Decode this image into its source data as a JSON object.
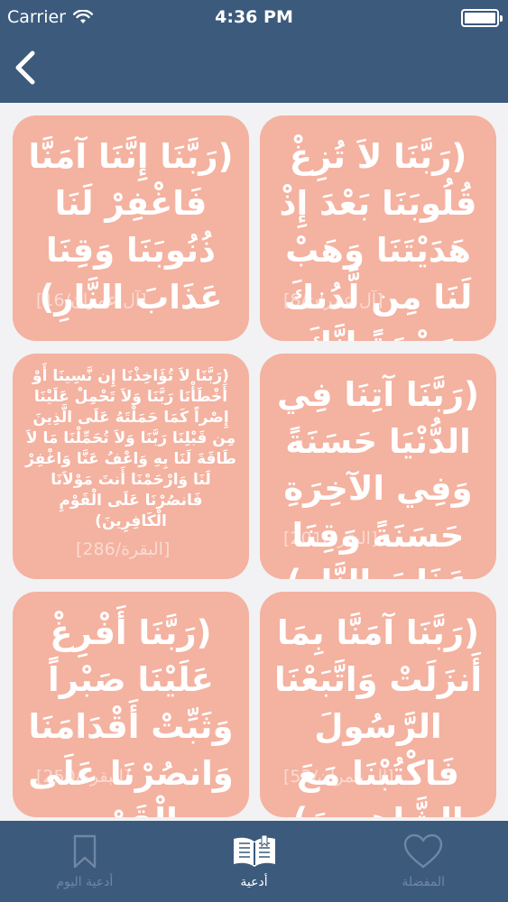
{
  "status": {
    "carrier": "Carrier",
    "time": "4:36 PM"
  },
  "cards": [
    {
      "text": "(رَبَّنَا لاَ تُزِغْ قُلُوبَنَا بَعْدَ إِذْ هَدَيْتَنَا وَهَبْ لَنَا مِن لَّدُنكَ رَحْمَةً إِنَّكَ أَنتَ الْوَهَّابُ)",
      "ref": "[آل عمران/8]"
    },
    {
      "text": "(رَبَّنَا إِنَّنَا آمَنَّا فَاغْفِرْ لَنَا ذُنُوبَنَا وَقِنَا عَذَابَ النَّارِ)",
      "ref": "[آل عمران/16]"
    },
    {
      "text": "(رَبَّنَا آتِنَا فِي الدُّنْيَا حَسَنَةً وَفِي الآخِرَةِ حَسَنَةً وَقِنَا عَذَابَ النَّارِ)",
      "ref": "[البقرة/201]"
    },
    {
      "text": "(رَبَّنَا لاَ تُؤَاخِذْنَا إِن نَّسِينَا أَوْ أَخْطَأْنَا رَبَّنَا وَلاَ تَحْمِلْ عَلَيْنَا إِصْراً كَمَا حَمَلْتَهُ عَلَى الَّذِينَ مِن قَبْلِنَا رَبَّنَا وَلاَ تُحَمِّلْنَا مَا لاَ طَاقَةَ لَنَا بِهِ وَاعْفُ عَنَّا وَاغْفِرْ لَنَا وَارْحَمْنَا أَنتَ مَوْلاَنَا فَانصُرْنَا عَلَى الْقَوْمِ الْكَافِرِينَ)",
      "ref": "[البقرة/286]"
    },
    {
      "text": "(رَبَّنَا آمَنَّا بِمَا أَنزَلَتْ وَاتَّبَعْنَا الرَّسُولَ فَاكْتُبْنَا مَعَ الشَّاهِدِينَ)",
      "ref": "[آل عمران/53]"
    },
    {
      "text": "(رَبَّنَا أَفْرِغْ عَلَيْنَا صَبْراً وَثَبِّتْ أَقْدَامَنَا وَانصُرْنَا عَلَى الْقَوْمِ الْكَافِرِينَ)",
      "ref": "[البقرة/250]"
    }
  ],
  "tabs": [
    {
      "label": "أدعية اليوم",
      "icon": "bookmark-icon"
    },
    {
      "label": "أدعية",
      "icon": "book-icon",
      "active": true
    },
    {
      "label": "المفضلة",
      "icon": "heart-icon"
    }
  ],
  "colors": {
    "header": "#3c5a7c",
    "card": "#f4b2a0",
    "inactive_tab": "#6f87a3"
  }
}
